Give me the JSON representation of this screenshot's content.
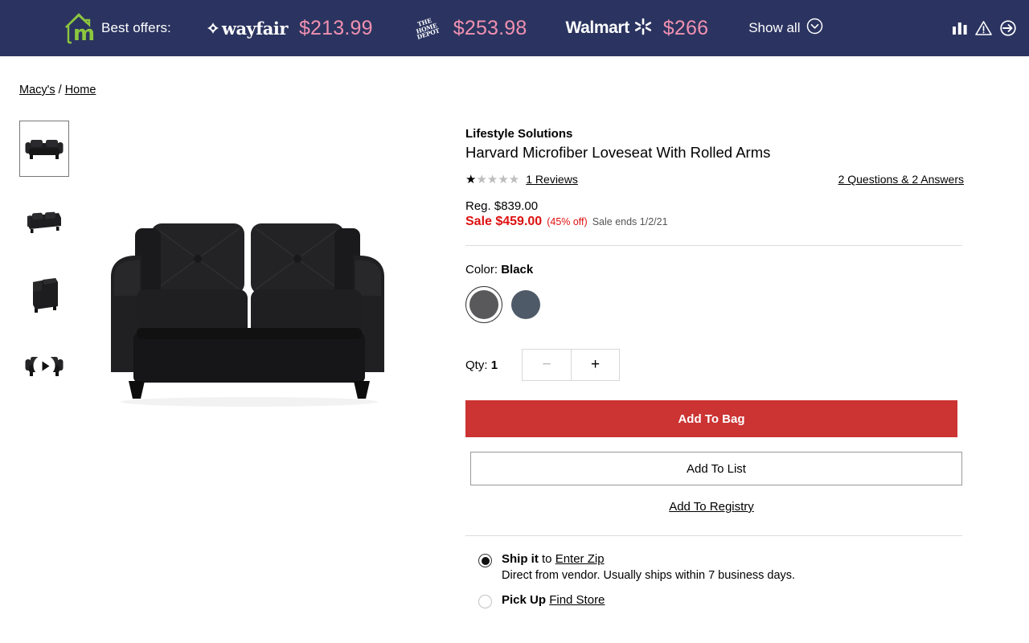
{
  "extension_bar": {
    "logo_icon": "house-m-logo-icon",
    "label": "Best offers:",
    "offers": [
      {
        "merchant": "wayfair",
        "merchant_icon": "wayfair-logo-icon",
        "price": "$213.99"
      },
      {
        "merchant": "The Home Depot",
        "merchant_icon": "home-depot-logo-icon",
        "price": "$253.98"
      },
      {
        "merchant": "Walmart",
        "merchant_icon": "walmart-logo-icon",
        "price": "$266"
      }
    ],
    "show_all_label": "Show all",
    "show_all_icon": "chevron-down-circle-icon",
    "icons": [
      "bar-chart-icon",
      "warning-triangle-icon",
      "sign-in-arrow-icon"
    ],
    "colors": {
      "background": "#2b3460",
      "price_text": "#f090b0",
      "logo_green": "#8cc63f"
    }
  },
  "breadcrumb": {
    "items": [
      "Macy's",
      "Home"
    ],
    "separator": "/"
  },
  "gallery": {
    "thumbnails": [
      {
        "name": "loveseat-front-view",
        "selected": true,
        "is_video": false
      },
      {
        "name": "loveseat-angled-view",
        "selected": false,
        "is_video": false
      },
      {
        "name": "loveseat-side-view",
        "selected": false,
        "is_video": false
      },
      {
        "name": "loveseat-video",
        "selected": false,
        "is_video": true
      }
    ],
    "hero_alt": "Black microfiber loveseat with rolled arms"
  },
  "product": {
    "brand": "Lifestyle Solutions",
    "title": "Harvard Microfiber Loveseat With Rolled Arms",
    "rating": {
      "filled_stars": 1,
      "total_stars": 5,
      "reviews_label": "1 Reviews"
    },
    "qa_label": "2 Questions & 2 Answers",
    "price": {
      "regular_label": "Reg. $839.00",
      "sale_label": "Sale $459.00",
      "percent_off": "(45% off)",
      "sale_ends": "Sale ends 1/2/21",
      "sale_color": "#dd1111"
    },
    "color": {
      "label_prefix": "Color:",
      "selected": "Black",
      "swatches": [
        {
          "name": "swatch-black",
          "hex": "#59585a",
          "selected": true
        },
        {
          "name": "swatch-gray",
          "hex": "#4e5a68",
          "selected": false
        }
      ]
    },
    "quantity": {
      "label_prefix": "Qty:",
      "value": "1",
      "decrement_label": "−",
      "increment_label": "+"
    },
    "actions": {
      "add_to_bag": "Add To Bag",
      "add_to_list": "Add To List",
      "add_to_registry": "Add To Registry",
      "bag_color": "#cc3333"
    },
    "fulfillment": [
      {
        "name": "ship-it",
        "selected": true,
        "title": "Ship it",
        "connector": "to",
        "link": "Enter Zip",
        "sub": "Direct from vendor. Usually ships within 7 business days."
      },
      {
        "name": "pick-up",
        "selected": false,
        "title": "Pick Up",
        "connector": "",
        "link": "Find Store",
        "sub": ""
      }
    ]
  }
}
